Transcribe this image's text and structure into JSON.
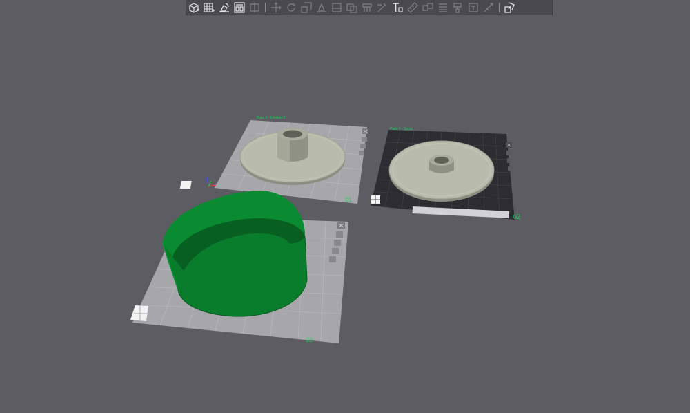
{
  "toolbar": {
    "buttons": [
      {
        "icon": "add-object-icon",
        "enabled": true
      },
      {
        "icon": "add-plate-icon",
        "enabled": true
      },
      {
        "icon": "auto-orient-icon",
        "enabled": true
      },
      {
        "icon": "arrange-icon",
        "enabled": true
      },
      {
        "icon": "split-icon",
        "enabled": false
      },
      {
        "icon": "move-icon",
        "enabled": false
      },
      {
        "icon": "rotate-icon",
        "enabled": false
      },
      {
        "icon": "scale-icon",
        "enabled": false
      },
      {
        "icon": "place-on-face-icon",
        "enabled": false
      },
      {
        "icon": "cut-icon",
        "enabled": false
      },
      {
        "icon": "mesh-boolean-icon",
        "enabled": false
      },
      {
        "icon": "support-paint-icon",
        "enabled": false
      },
      {
        "icon": "seam-paint-icon",
        "enabled": false
      },
      {
        "icon": "text-icon",
        "enabled": true
      },
      {
        "icon": "measure-icon",
        "enabled": false
      },
      {
        "icon": "assembly-icon",
        "enabled": false
      },
      {
        "icon": "variable-layer-icon",
        "enabled": false
      },
      {
        "icon": "color-paint-icon",
        "enabled": false
      },
      {
        "icon": "emboss-icon",
        "enabled": false
      },
      {
        "icon": "brim-ears-icon",
        "enabled": false
      },
      {
        "icon": "assembly-view-icon",
        "enabled": true
      }
    ]
  },
  "plates": [
    {
      "number": "01",
      "name": "Plate 1 - Untitled.3",
      "color": "#19d25b"
    },
    {
      "number": "02",
      "name": "Plate 2 - Spool",
      "color": "#19d25b"
    },
    {
      "number": "03",
      "name": "",
      "color": "#19d25b"
    }
  ],
  "colors": {
    "background": "#5d5c62",
    "plate_grey": "#a7a7ab",
    "plate_textured": "#2d2c31",
    "model_spool": "#b5b8a8",
    "model_ring": "#0a7d2c",
    "plate_label": "#19d25b"
  }
}
